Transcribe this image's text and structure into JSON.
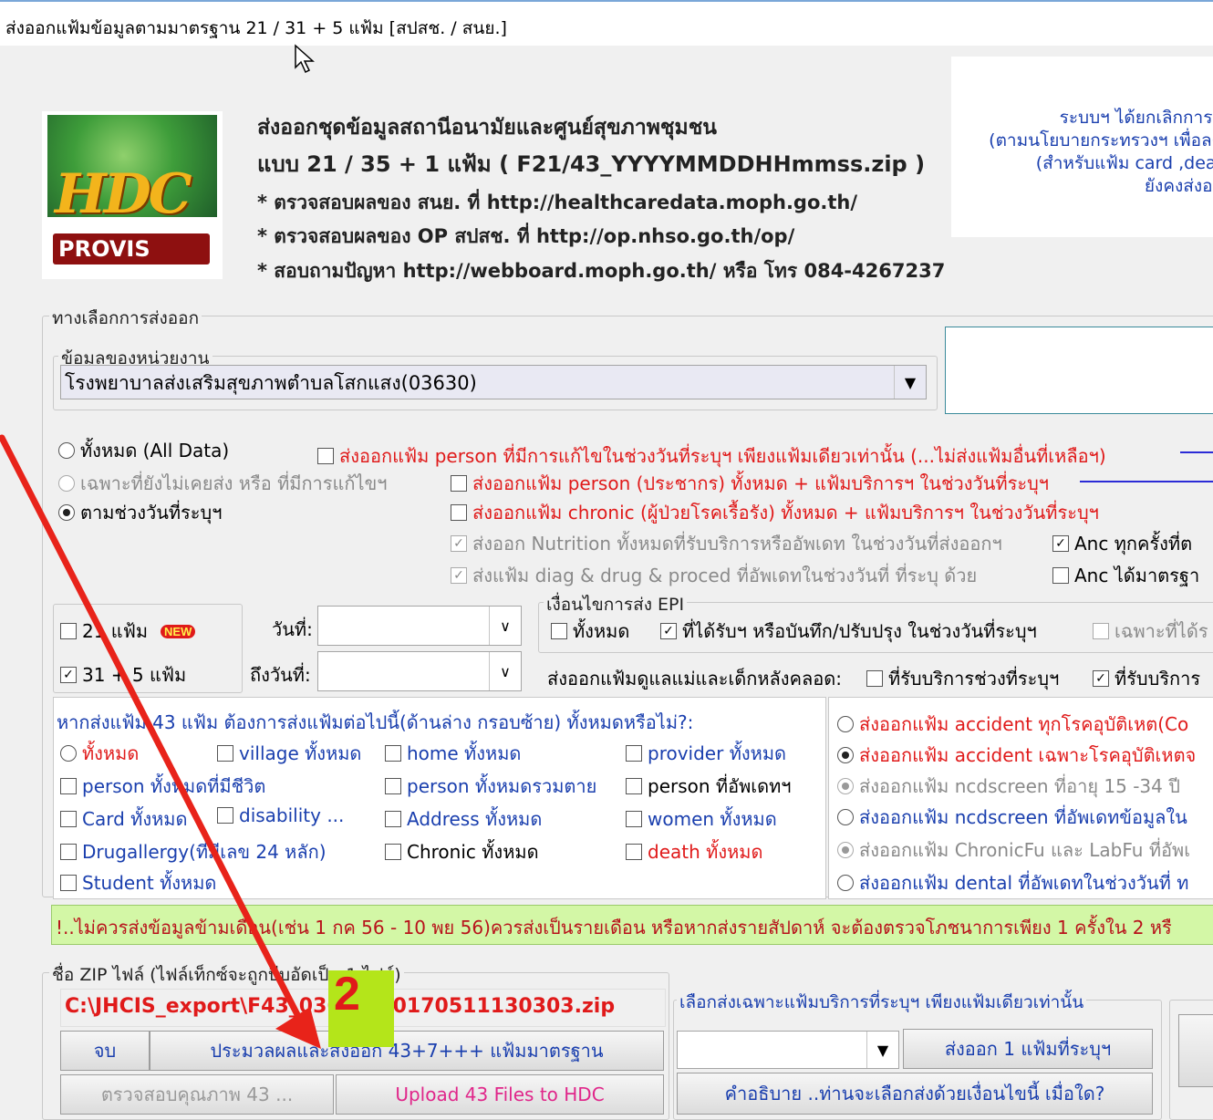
{
  "window": {
    "title": "ส่งออกแฟ้มข้อมูลตามมาตรฐาน 21 / 31 + 5 แฟ้ม [สปสช. / สนย.]"
  },
  "logo": {
    "main": "HDC",
    "sub": "PROVIS"
  },
  "header": {
    "line1": "ส่งออกชุดข้อมูลสถานีอนามัยและศูนย์สุขภาพชุมชน",
    "line2": "แบบ 21 / 35 + 1 แฟ้ม  ( F21/43_YYYYMMDDHHmmss.zip )",
    "line3": "* ตรวจสอบผลของ สนย. ที่ http://healthcaredata.moph.go.th/",
    "line4": "* ตรวจสอบผลของ OP สปสช. ที่ http://op.nhso.go.th/op/",
    "line5": "* สอบถามปัญหา http://webboard.moph.go.th/ หรือ โทร 084-4267237"
  },
  "notice": {
    "line1": "ระบบฯ ได้ยกเลิกการส่",
    "line2": "(ตามนโยบายกระทรวงฯ เพื่อลด",
    "line3": "(สำหรับแฟ้ม card ,deat",
    "line4": "ยังคงส่งออ"
  },
  "options": {
    "group_label": "ทางเลือกการส่งออก",
    "unit_label": "ข้อมูลของหน่วยงาน",
    "unit_value": "โรงพยาบาลส่งเสริมสุขภาพตำบลโสกแสง(03630)",
    "radio_all": "ทั้งหมด (All Data)",
    "radio_unsent": "เฉพาะที่ยังไม่เคยส่ง หรือ ที่มีการแก้ไขฯ",
    "radio_range": "ตามช่วงวันที่ระบุฯ",
    "chk_person_edit": "ส่งออกแฟ้ม person ที่มีการแก้ไขในช่วงวันที่ระบุฯ เพียงแฟ้มเดียวเท่านั้น (...ไม่ส่งแฟ้มอื่นที่เหลือฯ)",
    "chk_person_all": "ส่งออกแฟ้ม person (ประชากร) ทั้งหมด + แฟ้มบริการฯ ในช่วงวันที่ระบุฯ",
    "chk_chronic": "ส่งออกแฟ้ม chronic (ผู้ป่วยโรคเรื้อรัง) ทั้งหมด + แฟ้มบริการฯ ในช่วงวันที่ระบุฯ",
    "chk_nutrition": "ส่งออก Nutrition ทั้งหมดที่รับบริการหรืออัพเดท ในช่วงวันที่ส่งออกฯ",
    "chk_anc_all": "Anc ทุกครั้งที่ต",
    "chk_diag": "ส่งแฟ้ม diag & drug & proced ที่อัพเดทในช่วงวันที่ ที่ระบุ ด้วย",
    "chk_anc_std": "Anc ได้มาตรฐา"
  },
  "files": {
    "f21": "21 แฟ้ม",
    "new_tag": "NEW",
    "f31": "31 + 5 แฟ้ม",
    "date_from_label": "วันที่:",
    "date_to_label": "ถึงวันที่:",
    "date_from": "",
    "date_to": ""
  },
  "epi": {
    "group_label": "เงื่อนไขการส่ง EPI",
    "all": "ทั้งหมด",
    "received": "ที่ได้รับฯ หรือบันทึก/ปรับปรุง ในช่วงวันที่ระบุฯ",
    "only": "เฉพาะที่ได้ร",
    "postnatal_label": "ส่งออกแฟ้มดูแลแม่และเด็กหลังคลอด:",
    "postnatal_range": "ที่รับบริการช่วงที่ระบุฯ",
    "postnatal_service": "ที่รับบริการ"
  },
  "extra": {
    "question": "หากส่งแฟ้ม 43 แฟ้ม ต้องการส่งแฟ้มต่อไปนี้(ด้านล่าง กรอบซ้าย) ทั้งหมดหรือไม่?:",
    "all": "ทั้งหมด",
    "village": "village ทั้งหมด",
    "home": "home ทั้งหมด",
    "provider": "provider ทั้งหมด",
    "person_alive": "person ทั้งหมดที่มีชีวิต",
    "person_dead": "person ทั้งหมดรวมตาย",
    "person_updated": "person ที่อัพเดทฯ",
    "card": "Card ทั้งหมด",
    "disability": "disability ...",
    "address": "Address ทั้งหมด",
    "women": "women ทั้งหมด",
    "drugallergy": "Drugallergy(ที่มีเลข 24 หลัก)",
    "chronic": "Chronic ทั้งหมด",
    "death": "death ทั้งหมด",
    "student": "Student ทั้งหมด"
  },
  "right_radios": {
    "accident_all": "ส่งออกแฟ้ม accident ทุกโรคอุบัติเหต(Co",
    "accident_only": "ส่งออกแฟ้ม accident เฉพาะโรคอุบัติเหตจ",
    "ncd_age": "ส่งออกแฟ้ม ncdscreen ที่อายุ 15 -34 ปี",
    "ncd_updated": "ส่งออกแฟ้ม ncdscreen ที่อัพเดทข้อมูลใน",
    "chronicfu": "ส่งออกแฟ้ม ChronicFu และ LabFu ที่อัพเ",
    "dental": "ส่งออกแฟ้ม dental ที่อัพเดทในช่วงวันที่ ท"
  },
  "warning": "!..ไม่ควรส่งข้อมูลข้ามเดือน(เช่น 1 กค 56 - 10 พย 56)ควรส่งเป็นรายเดือน หรือหากส่งรายสัปดาห์ จะต้องตรวจโภชนาการเพียง 1 ครั้งใน 2 หรื",
  "zip": {
    "group_label": "ชื่อ ZIP ไฟล์ (ไฟล์เท็กซ์จะถูกบีบอัดเป็น 1 ไฟล์)",
    "path": "C:\\JHCIS_export\\F43_03630_20170511130303.zip",
    "btn_exit": "จบ",
    "btn_process": "ประมวลผลและส่งออก 43+7+++ แฟ้มมาตรฐาน",
    "btn_check": "ตรวจสอบคุณภาพ 43 ...",
    "btn_upload": "Upload 43 Files to HDC"
  },
  "single": {
    "group_label": "เลือกส่งเฉพาะแฟ้มบริการที่ระบุฯ เพียงแฟ้มเดียวเท่านั้น",
    "selected": "",
    "btn_export_one": "ส่งออก 1 แฟ้มที่ระบุฯ",
    "btn_explain": "คำอธิบาย ..ท่านจะเลือกส่งด้วยเงื่อนไขนี้ เมื่อใด?"
  },
  "annotation": {
    "step_number": "2",
    "arrow_color": "#e8231a",
    "badge_color": "#b4e51a"
  }
}
